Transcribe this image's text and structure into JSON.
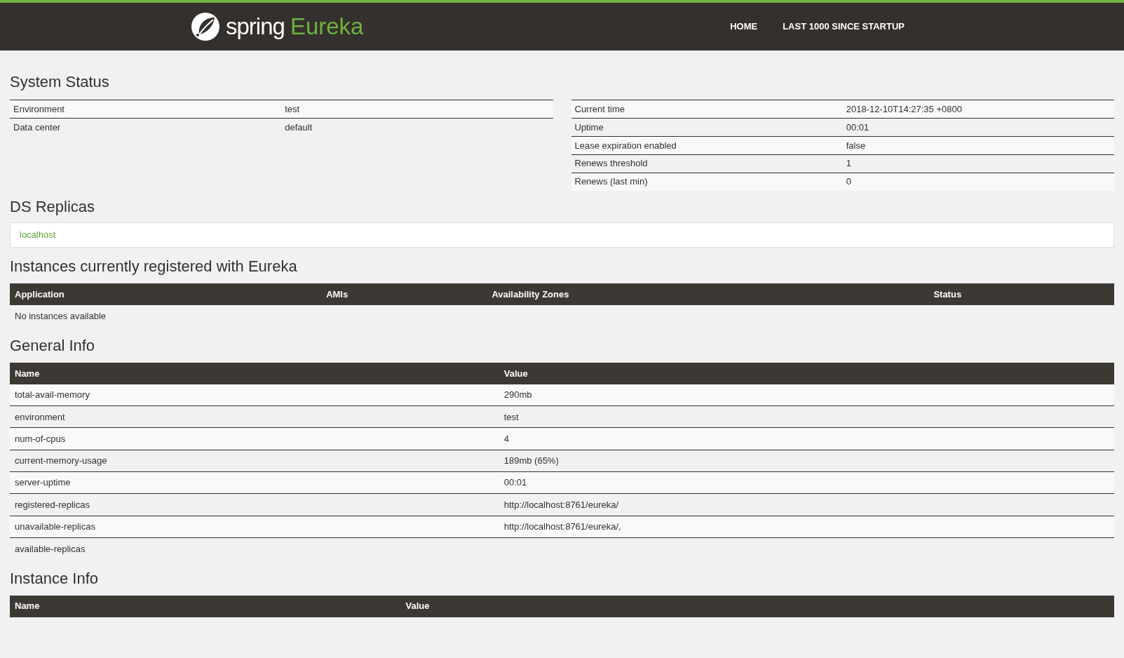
{
  "navbar": {
    "brand": "spring",
    "product": "Eureka",
    "links": [
      {
        "label": "HOME"
      },
      {
        "label": "LAST 1000 SINCE STARTUP"
      }
    ]
  },
  "system_status": {
    "title": "System Status",
    "left": [
      {
        "name": "Environment",
        "value": "test"
      },
      {
        "name": "Data center",
        "value": "default"
      }
    ],
    "right": [
      {
        "name": "Current time",
        "value": "2018-12-10T14:27:35 +0800"
      },
      {
        "name": "Uptime",
        "value": "00:01"
      },
      {
        "name": "Lease expiration enabled",
        "value": "false"
      },
      {
        "name": "Renews threshold",
        "value": "1"
      },
      {
        "name": "Renews (last min)",
        "value": "0"
      }
    ]
  },
  "ds_replicas": {
    "title": "DS Replicas",
    "items": [
      "localhost"
    ]
  },
  "instances": {
    "title": "Instances currently registered with Eureka",
    "columns": [
      "Application",
      "AMIs",
      "Availability Zones",
      "Status"
    ],
    "empty_message": "No instances available"
  },
  "general_info": {
    "title": "General Info",
    "columns": [
      "Name",
      "Value"
    ],
    "rows": [
      {
        "name": "total-avail-memory",
        "value": "290mb"
      },
      {
        "name": "environment",
        "value": "test"
      },
      {
        "name": "num-of-cpus",
        "value": "4"
      },
      {
        "name": "current-memory-usage",
        "value": "189mb (65%)"
      },
      {
        "name": "server-uptime",
        "value": "00:01"
      },
      {
        "name": "registered-replicas",
        "value": "http://localhost:8761/eureka/"
      },
      {
        "name": "unavailable-replicas",
        "value": "http://localhost:8761/eureka/,"
      },
      {
        "name": "available-replicas",
        "value": ""
      }
    ]
  },
  "instance_info": {
    "title": "Instance Info",
    "columns": [
      "Name",
      "Value"
    ]
  }
}
